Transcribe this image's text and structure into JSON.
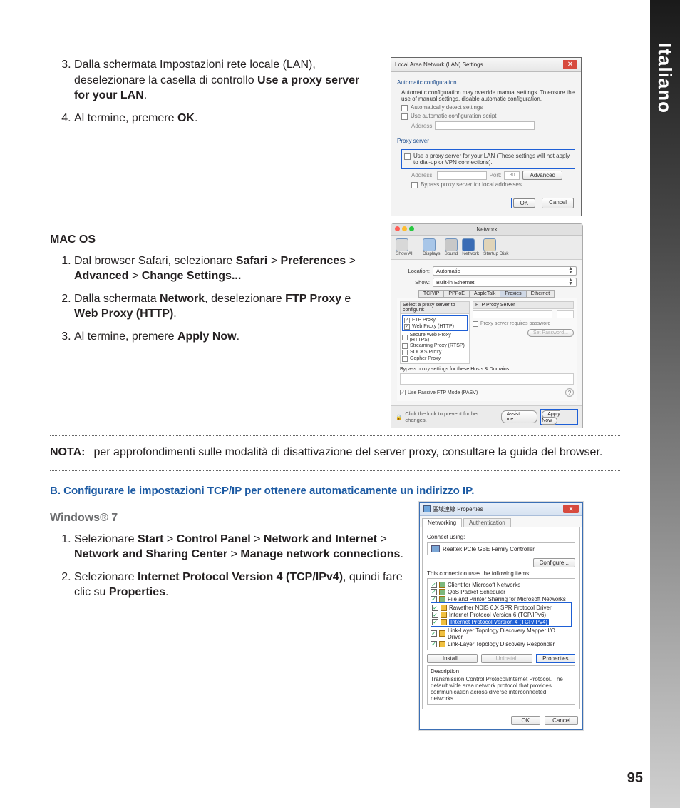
{
  "sideTab": "Italiano",
  "pageNumber": "95",
  "section1": {
    "step3_a": "Dalla schermata Impostazioni rete locale (LAN), deselezionare la casella di controllo ",
    "step3_b": "Use a proxy server for your LAN",
    "step3_c": ".",
    "step4_a": "Al termine, premere ",
    "step4_b": "OK",
    "step4_c": "."
  },
  "lanDlg": {
    "title": "Local Area Network (LAN) Settings",
    "grp1": "Automatic configuration",
    "grp1txt": "Automatic configuration may override manual settings.  To ensure the use of manual settings, disable automatic configuration.",
    "auto1": "Automatically detect settings",
    "auto2": "Use automatic configuration script",
    "addr": "Address",
    "grp2": "Proxy server",
    "proxyTxt": "Use a proxy server for your LAN (These settings will not apply to dial-up or VPN connections).",
    "addr2": "Address:",
    "port": "Port:",
    "portVal": "80",
    "adv": "Advanced",
    "bypass": "Bypass proxy server for local addresses",
    "ok": "OK",
    "cancel": "Cancel"
  },
  "macHead": "MAC OS",
  "mac": {
    "s1a": "Dal browser Safari, selezionare ",
    "s1b": "Safari",
    "gt": " > ",
    "s1c": "Preferences",
    "s1d": "Advanced",
    "s1e": "Change  Settings...",
    "s2a": "Dalla schermata ",
    "s2b": "Network",
    "s2c": ", deselezionare ",
    "s2d": "FTP Proxy",
    "s2e": " e ",
    "s2f": "Web Proxy (HTTP)",
    "s2g": ".",
    "s3a": "Al termine, premere ",
    "s3b": "Apply Now",
    "s3c": "."
  },
  "macDlg": {
    "title": "Network",
    "showAll": "Show All",
    "tDisplays": "Displays",
    "tSound": "Sound",
    "tNetwork": "Network",
    "tStartup": "Startup Disk",
    "loc": "Location:",
    "locVal": "Automatic",
    "show": "Show:",
    "showVal": "Built-in Ethernet",
    "tab1": "TCP/IP",
    "tab2": "PPPoE",
    "tab3": "AppleTalk",
    "tab4": "Proxies",
    "tab5": "Ethernet",
    "selHdr": "Select a proxy server to configure:",
    "ftpHdr": "FTP Proxy Server",
    "p1": "FTP Proxy",
    "p2": "Web Proxy (HTTP)",
    "p3": "Secure Web Proxy (HTTPS)",
    "p4": "Streaming Proxy (RTSP)",
    "p5": "SOCKS Proxy",
    "p6": "Gopher Proxy",
    "reqPass": "Proxy server requires password",
    "setPass": "Set Password...",
    "bypass": "Bypass proxy settings for these Hosts & Domains:",
    "pasv": "Use Passive FTP Mode (PASV)",
    "lock": "Click the lock to prevent further changes.",
    "assist": "Assist me...",
    "apply": "Apply Now"
  },
  "nota": {
    "lbl": "NOTA:",
    "txt": "per approfondimenti sulle modalità di disattivazione del server proxy, consultare la guida del browser."
  },
  "blueHead": "B.   Configurare le impostazioni TCP/IP per ottenere automaticamente un indirizzo IP.",
  "win7Head": "Windows® 7",
  "win7": {
    "s1a": "Selezionare ",
    "s1b": "Start",
    "s1c": "Control Panel",
    "s1d": "Network and Internet",
    "s1e": "Network and Sharing Center",
    "s1f": "Manage network connections",
    "s1g": ".",
    "s2a": "Selezionare ",
    "s2b": "Internet Protocol Version 4 (TCP/IPv4)",
    "s2c": ", quindi fare clic su ",
    "s2d": "Properties",
    "s2e": "."
  },
  "w7Dlg": {
    "title": "區域連線 Properties",
    "tab1": "Networking",
    "tab2": "Authentication",
    "connUsing": "Connect using:",
    "adapter": "Realtek PCIe GBE Family Controller",
    "config": "Configure...",
    "uses": "This connection uses the following items:",
    "i1": "Client for Microsoft Networks",
    "i2": "QoS Packet Scheduler",
    "i3": "File and Printer Sharing for Microsoft Networks",
    "i4": "Rawether NDIS 6.X SPR Protocol Driver",
    "i5": "Internet Protocol Version 6 (TCP/IPv6)",
    "i6": "Internet Protocol Version 4 (TCP/IPv4)",
    "i7": "Link-Layer Topology Discovery Mapper I/O Driver",
    "i8": "Link-Layer Topology Discovery Responder",
    "install": "Install...",
    "uninstall": "Uninstall",
    "props": "Properties",
    "descLbl": "Description",
    "desc": "Transmission Control Protocol/Internet Protocol. The default wide area network protocol that provides communication across diverse interconnected networks.",
    "ok": "OK",
    "cancel": "Cancel"
  }
}
